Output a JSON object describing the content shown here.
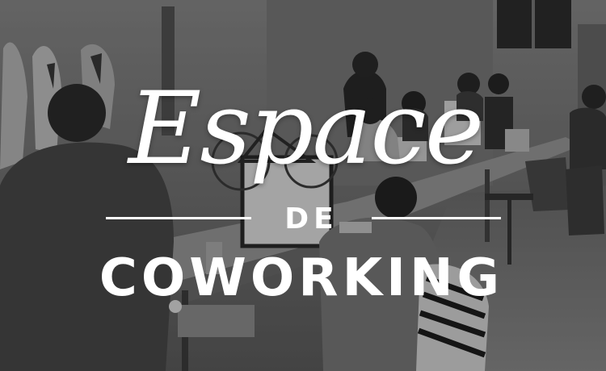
{
  "title": {
    "script_word": "Espace",
    "connector": "DE",
    "block_word": "COWORKING"
  },
  "colors": {
    "text": "#ffffff",
    "photo_tone": "grayscale"
  }
}
